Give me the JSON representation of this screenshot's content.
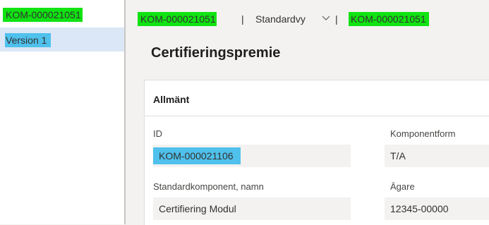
{
  "nav": {
    "items": [
      {
        "label": "KOM-000021051"
      },
      {
        "label": "Version 1"
      }
    ]
  },
  "header": {
    "record": "KOM-000021051",
    "separator": "|",
    "view": "Standardvy",
    "form_id": "KOM-000021051"
  },
  "page": {
    "title": "Certifieringspremie"
  },
  "section": {
    "title": "Allmänt"
  },
  "fields": {
    "id": {
      "label": "ID",
      "value": "KOM-000021106"
    },
    "component_form": {
      "label": "Komponentform",
      "value": "T/A"
    },
    "standard_name": {
      "label": "Standardkomponent, namn",
      "value": "Certifiering Modul"
    },
    "owner": {
      "label": "Ägare",
      "value": "12345-00000"
    }
  },
  "colors": {
    "highlight_green": "#10e312",
    "highlight_blue": "#4fc1ec",
    "selected_nav": "#dbe7f6"
  },
  "icons": {
    "view_dropdown": "chevron-down-icon"
  }
}
